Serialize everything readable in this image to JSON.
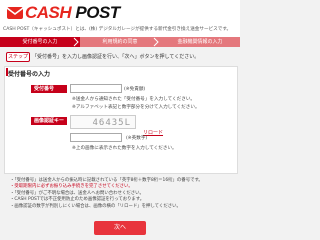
{
  "header": {
    "logo": {
      "cash": "CASH",
      "post": "POST"
    },
    "tagline": "CASH POST（キャッシュポスト）とは、(株) デジタルガレージが提供する新代金引き換え送金サービスです。"
  },
  "steps": [
    {
      "label": "受付番号の入力",
      "active": true
    },
    {
      "label": "利用規約の同意",
      "active": false
    },
    {
      "label": "金融機関情報の入力",
      "active": false
    }
  ],
  "steps_button": "ステップ",
  "instruction": "「受付番号」を入力し画像認証を行い、「次へ」ボタンを押してください。",
  "panel": {
    "title": "受付番号の入力",
    "receipt_label": "受付番号",
    "receipt_value": "",
    "receipt_hint": "(※免責額)",
    "notes": [
      "※送金人から通知された「受付番号」を入力してください。",
      "※アルファベット表記と数字部分を分けて入力してください。"
    ],
    "captcha_label": "画像認証キー",
    "captcha_text": "46435L",
    "reload_link": "リロード",
    "captcha_hint": "(※英数字)",
    "captcha_note": "※上の画像に表示された数字を入力してください。"
  },
  "bullets": [
    {
      "text": "・「受付番号」は送金人からの振込時に記載されている「英字8桁＋数字8桁＝16桁」の番号です。",
      "accent": false
    },
    {
      "text": "・受取期限内に必ずお振り込み手続きを完了させてください。",
      "accent": true
    },
    {
      "text": "・「受付番号」がご不明な場合は、送金人へお問い合わせください。",
      "accent": false
    },
    {
      "text": "・CASH POSTでは不正使用防止のため画像認証を行っております。",
      "accent": false
    },
    {
      "text": "・画像認証の数字が判別しにくい場合は、画像の横の「リロード」を押してください。",
      "accent": false
    }
  ],
  "next_button": "次へ",
  "colors": {
    "brand": "#c6001a",
    "button": "#e8343c",
    "inactive_step": "#e4787d"
  }
}
